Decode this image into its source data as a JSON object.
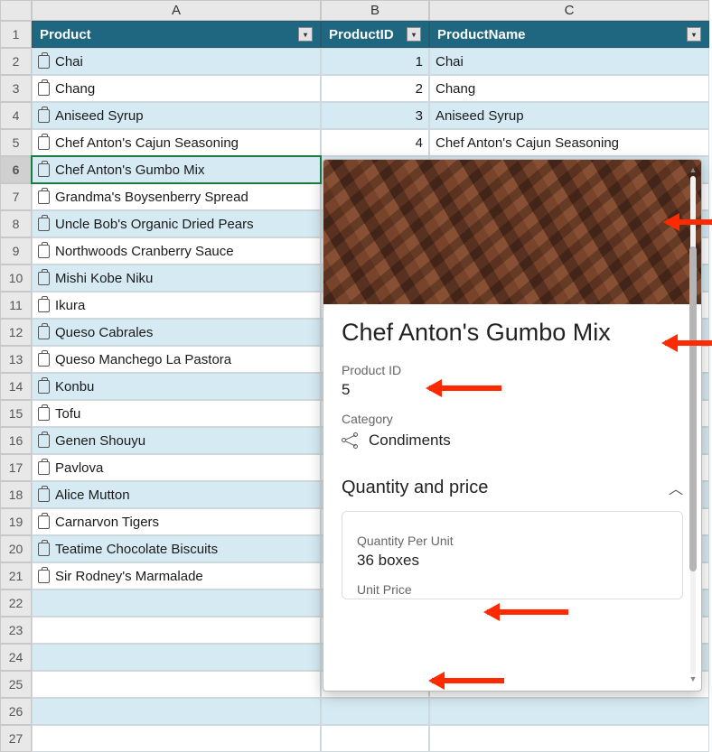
{
  "columns": {
    "A": "A",
    "B": "B",
    "C": "C"
  },
  "headers": {
    "product": "Product",
    "productId": "ProductID",
    "productName": "ProductName"
  },
  "rows": [
    {
      "num": 1
    },
    {
      "num": 2,
      "product": "Chai",
      "productId": "1",
      "productName": "Chai"
    },
    {
      "num": 3,
      "product": "Chang",
      "productId": "2",
      "productName": "Chang"
    },
    {
      "num": 4,
      "product": "Aniseed Syrup",
      "productId": "3",
      "productName": "Aniseed Syrup"
    },
    {
      "num": 5,
      "product": "Chef Anton's Cajun Seasoning",
      "productId": "4",
      "productName": "Chef Anton's Cajun Seasoning"
    },
    {
      "num": 6,
      "product": "Chef Anton's Gumbo Mix",
      "selected": true
    },
    {
      "num": 7,
      "product": "Grandma's Boysenberry Spread"
    },
    {
      "num": 8,
      "product": "Uncle Bob's Organic Dried Pears"
    },
    {
      "num": 9,
      "product": "Northwoods Cranberry Sauce"
    },
    {
      "num": 10,
      "product": "Mishi Kobe Niku"
    },
    {
      "num": 11,
      "product": "Ikura"
    },
    {
      "num": 12,
      "product": "Queso Cabrales"
    },
    {
      "num": 13,
      "product": "Queso Manchego La Pastora"
    },
    {
      "num": 14,
      "product": "Konbu"
    },
    {
      "num": 15,
      "product": "Tofu"
    },
    {
      "num": 16,
      "product": "Genen Shouyu"
    },
    {
      "num": 17,
      "product": "Pavlova"
    },
    {
      "num": 18,
      "product": "Alice Mutton"
    },
    {
      "num": 19,
      "product": "Carnarvon Tigers"
    },
    {
      "num": 20,
      "product": "Teatime Chocolate Biscuits"
    },
    {
      "num": 21,
      "product": "Sir Rodney's Marmalade"
    },
    {
      "num": 22
    },
    {
      "num": 23
    },
    {
      "num": 24
    },
    {
      "num": 25
    },
    {
      "num": 26
    },
    {
      "num": 27
    }
  ],
  "card": {
    "title": "Chef Anton's Gumbo Mix",
    "productIdLabel": "Product ID",
    "productId": "5",
    "categoryLabel": "Category",
    "category": "Condiments",
    "sectionTitle": "Quantity and price",
    "qpuLabel": "Quantity Per Unit",
    "qpu": "36 boxes",
    "unitPriceLabel": "Unit Price"
  }
}
